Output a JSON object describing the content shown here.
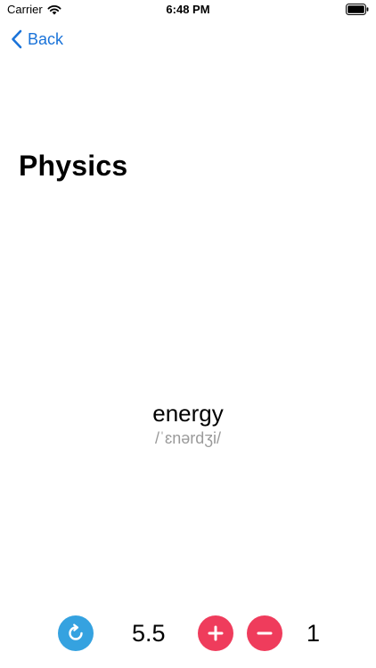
{
  "status_bar": {
    "carrier": "Carrier",
    "time": "6:48 PM",
    "wifi_icon": "wifi-icon",
    "battery_icon": "battery-icon"
  },
  "nav": {
    "back_label": "Back",
    "back_icon": "chevron-left-icon"
  },
  "page": {
    "title": "Physics"
  },
  "card": {
    "word": "energy",
    "phonetic": "/ˈɛnərdʒi/"
  },
  "controls": {
    "refresh_icon": "refresh-icon",
    "rating": "5.5",
    "plus_icon": "plus-icon",
    "minus_icon": "minus-icon",
    "count": "1"
  },
  "colors": {
    "accent": "#1a73d9",
    "refresh": "#35a2e0",
    "action": "#ef3c5c",
    "phonetic": "#9a9a9a"
  }
}
